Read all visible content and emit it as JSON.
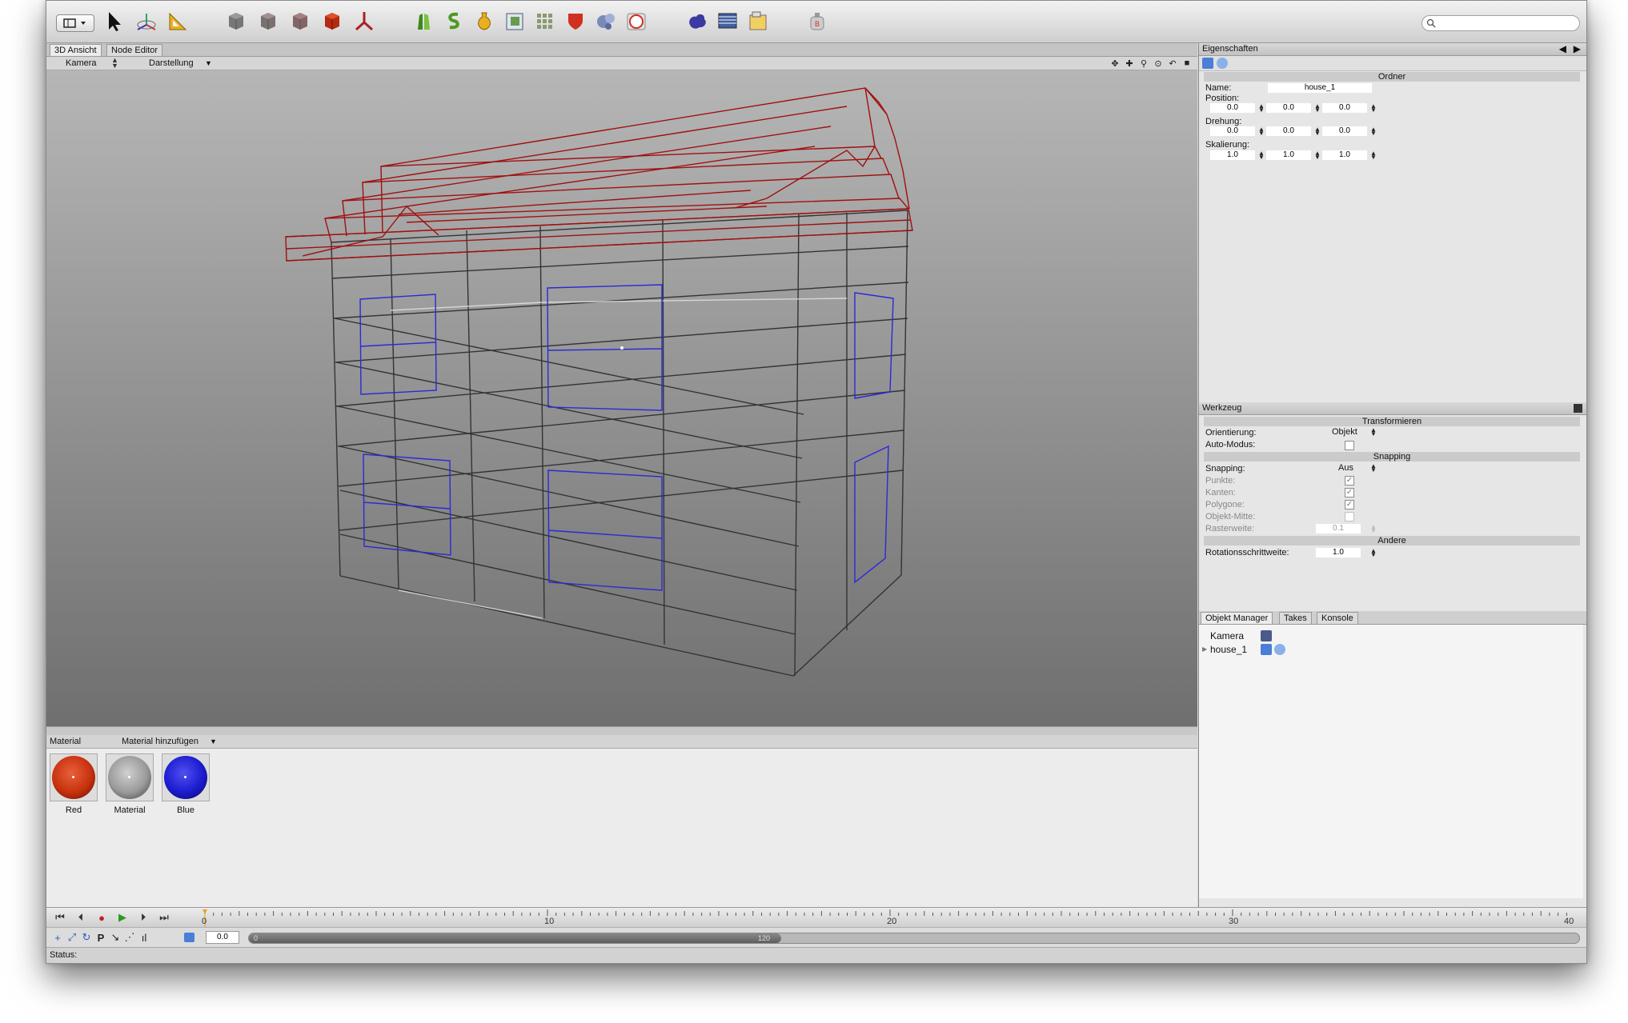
{
  "toolbar": {
    "search_placeholder": "",
    "icons": [
      "layout-selector-icon",
      "select-arrow-icon",
      "transform-tool-icon",
      "ruler-tool-icon",
      "cube-gray-1-icon",
      "cube-gray-2-icon",
      "cube-gray-3-icon",
      "cube-red-icon",
      "axis-tool-icon",
      "extrude-icon",
      "spline-icon",
      "vase-icon",
      "frame-cube-icon",
      "array-icon",
      "shield-icon",
      "molecule-icon",
      "sphere-light-icon",
      "cloud-icon",
      "render-picture-icon",
      "render-settings-icon",
      "plugin-icon"
    ]
  },
  "viewport": {
    "tabs": [
      "3D Ansicht",
      "Node Editor"
    ],
    "camera_menu": "Kamera",
    "display_menu": "Darstellung"
  },
  "materials": {
    "header": "Material",
    "add_menu": "Material hinzufügen",
    "items": [
      {
        "label": "Red",
        "color": "#c8320e"
      },
      {
        "label": "Material",
        "color": "#9a9a9a"
      },
      {
        "label": "Blue",
        "color": "#1c1cd0"
      }
    ]
  },
  "timeline": {
    "ticks": [
      "0",
      "10",
      "20",
      "30",
      "40"
    ],
    "current_frame": "0.0",
    "range_start": "0",
    "range_end": "120"
  },
  "status": {
    "label": "Status:"
  },
  "properties": {
    "title": "Eigenschaften",
    "section": "Ordner",
    "name_label": "Name:",
    "name_value": "house_1",
    "position_label": "Position:",
    "position": [
      "0.0",
      "0.0",
      "0.0"
    ],
    "rotation_label": "Drehung:",
    "rotation": [
      "0.0",
      "0.0",
      "0.0"
    ],
    "scale_label": "Skalierung:",
    "scale": [
      "1.0",
      "1.0",
      "1.0"
    ]
  },
  "tool": {
    "title": "Werkzeug",
    "transform_section": "Transformieren",
    "orientation_label": "Orientierung:",
    "orientation_value": "Objekt",
    "auto_mode_label": "Auto-Modus:",
    "snapping_section": "Snapping",
    "snapping_label": "Snapping:",
    "snapping_value": "Aus",
    "points_label": "Punkte:",
    "edges_label": "Kanten:",
    "polygons_label": "Polygone:",
    "object_center_label": "Objekt-Mitte:",
    "grid_label": "Rasterweite:",
    "grid_value": "0.1",
    "other_section": "Andere",
    "rotation_step_label": "Rotationsschrittweite:",
    "rotation_step_value": "1.0"
  },
  "object_manager": {
    "tabs": [
      "Objekt Manager",
      "Takes",
      "Konsole"
    ],
    "items": [
      {
        "name": "Kamera"
      },
      {
        "name": "house_1"
      }
    ]
  }
}
